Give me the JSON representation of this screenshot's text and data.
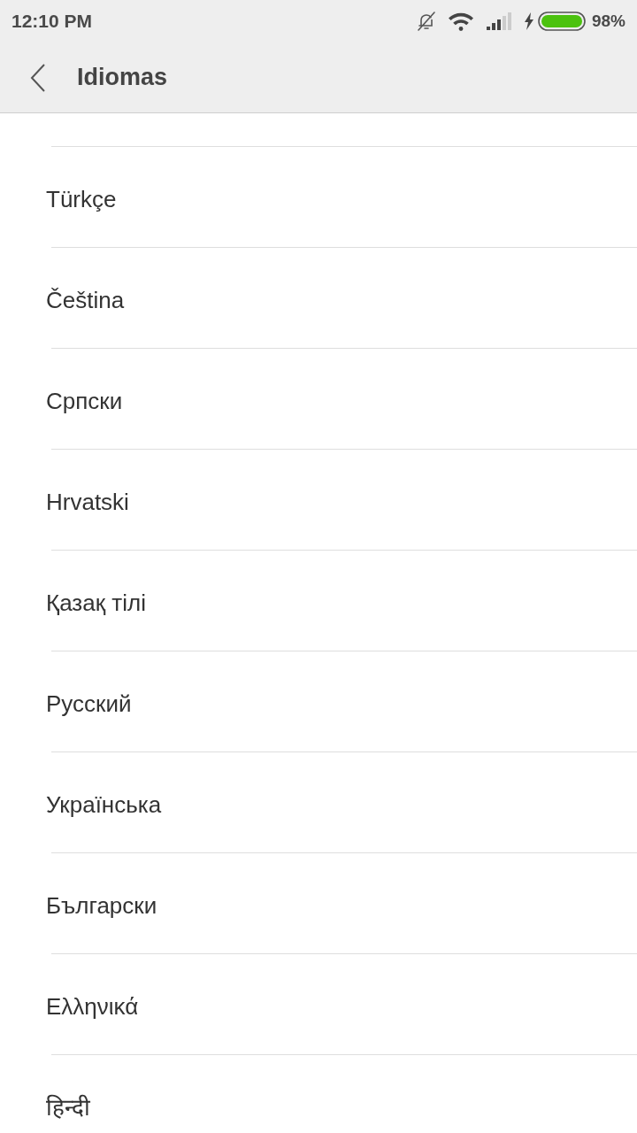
{
  "status_bar": {
    "time": "12:10 PM",
    "battery_percent": "98%"
  },
  "app_bar": {
    "title": "Idiomas"
  },
  "languages": [
    {
      "label": "Türkçe"
    },
    {
      "label": "Čeština"
    },
    {
      "label": "Српски"
    },
    {
      "label": "Hrvatski"
    },
    {
      "label": "Қазақ тілі"
    },
    {
      "label": "Русский"
    },
    {
      "label": "Українська"
    },
    {
      "label": "Български"
    },
    {
      "label": "Ελληνικά"
    },
    {
      "label": "हिन्दी"
    }
  ]
}
